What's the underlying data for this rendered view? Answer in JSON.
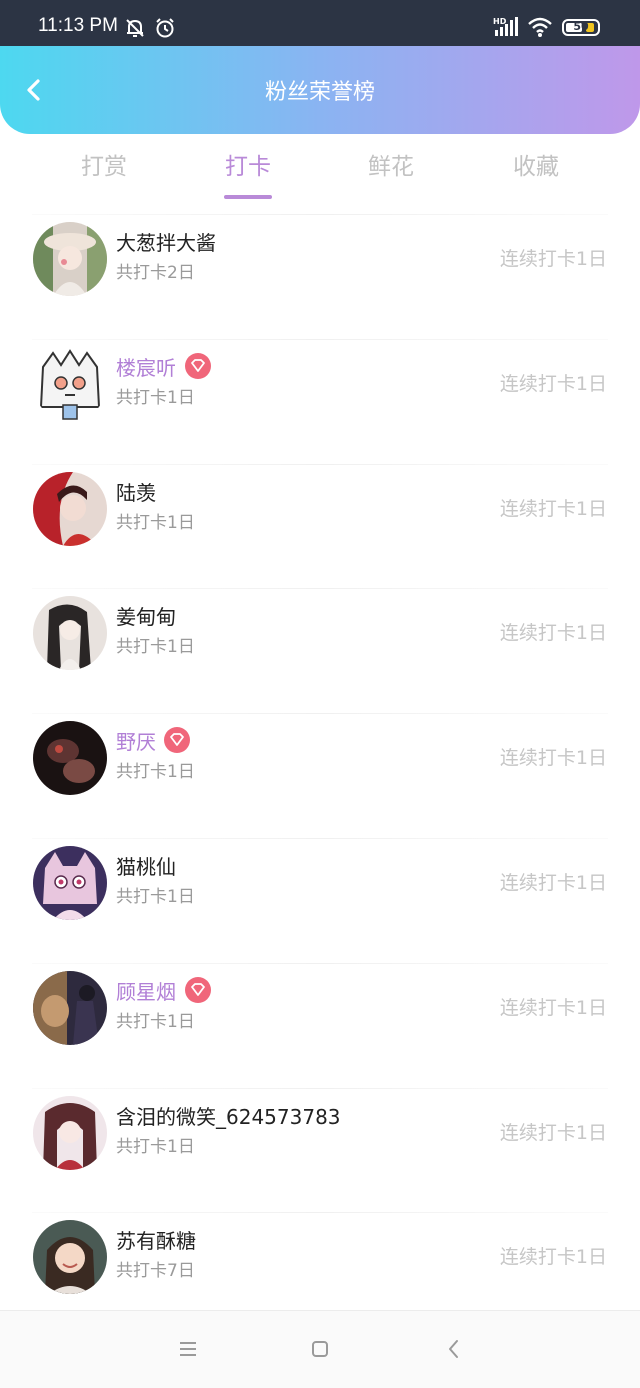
{
  "status_bar": {
    "time": "11:13 PM",
    "battery": "50",
    "network": "HD",
    "icons": [
      "mute-icon",
      "alarm-icon",
      "signal-icon",
      "wifi-icon",
      "battery-icon"
    ]
  },
  "header": {
    "title": "粉丝荣誉榜",
    "back_icon": "chevron-left-icon",
    "gradient": [
      "#4dd8f0",
      "#bf98ea"
    ]
  },
  "tabs": [
    {
      "label": "打赏",
      "active": false
    },
    {
      "label": "打卡",
      "active": true
    },
    {
      "label": "鲜花",
      "active": false
    },
    {
      "label": "收藏",
      "active": false
    }
  ],
  "colors": {
    "accent": "#b98ad8",
    "vip_name": "#b17fd6",
    "vip_badge": "#f0667a",
    "muted_text": "#9a9a9a",
    "streak_text": "#c6c6c6"
  },
  "rows": [
    {
      "name": "大葱拌大酱",
      "vip": false,
      "total": "共打卡2日",
      "streak": "连续打卡1日"
    },
    {
      "name": "楼宸听",
      "vip": true,
      "total": "共打卡1日",
      "streak": "连续打卡1日"
    },
    {
      "name": "陆羡",
      "vip": false,
      "total": "共打卡1日",
      "streak": "连续打卡1日"
    },
    {
      "name": "姜甸甸",
      "vip": false,
      "total": "共打卡1日",
      "streak": "连续打卡1日"
    },
    {
      "name": "野厌",
      "vip": true,
      "total": "共打卡1日",
      "streak": "连续打卡1日"
    },
    {
      "name": "猫桃仙",
      "vip": false,
      "total": "共打卡1日",
      "streak": "连续打卡1日"
    },
    {
      "name": "顾星烟",
      "vip": true,
      "total": "共打卡1日",
      "streak": "连续打卡1日"
    },
    {
      "name": "含泪的微笑_624573783",
      "vip": false,
      "total": "共打卡1日",
      "streak": "连续打卡1日"
    },
    {
      "name": "苏有酥糖",
      "vip": false,
      "total": "共打卡7日",
      "streak": "连续打卡1日"
    }
  ],
  "nav_bar": {
    "icons": [
      "menu-icon",
      "home-square-icon",
      "back-triangle-icon"
    ]
  }
}
